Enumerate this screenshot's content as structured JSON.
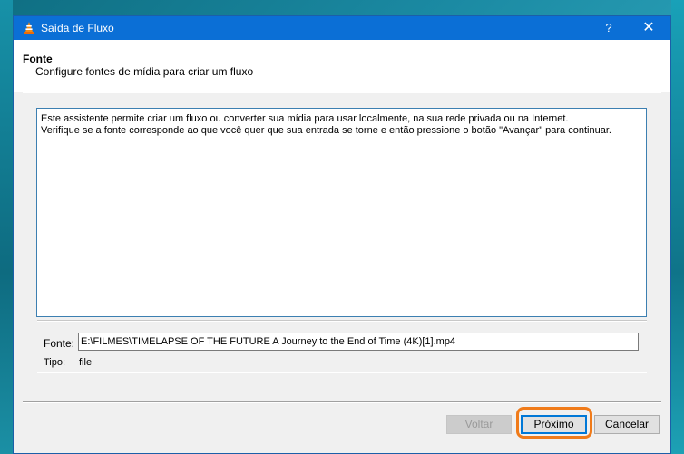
{
  "window": {
    "title": "Saída de Fluxo",
    "help_label": "?",
    "close_label": "✕",
    "accent_color": "#0b6fd6"
  },
  "header": {
    "title": "Fonte",
    "subtitle": "Configure fontes de mídia para criar um fluxo"
  },
  "info": {
    "line1": "Este assistente permite criar um fluxo ou converter sua mídia para usar localmente, na sua rede privada ou na Internet.",
    "line2": "Verifique se a fonte corresponde ao que você quer que sua entrada se torne e então pressione o botão \"Avançar\" para continuar."
  },
  "source": {
    "label": "Fonte:",
    "value": "E:\\FILMES\\TIMELAPSE OF THE FUTURE A Journey to the End of Time (4K)[1].mp4",
    "type_label": "Tipo:",
    "type_value": "file"
  },
  "buttons": {
    "back": "Voltar",
    "next": "Próximo",
    "cancel": "Cancelar"
  },
  "icons": {
    "app": "vlc-cone-icon",
    "help": "help-icon",
    "close": "close-icon"
  },
  "highlight_color": "#f07b1a"
}
